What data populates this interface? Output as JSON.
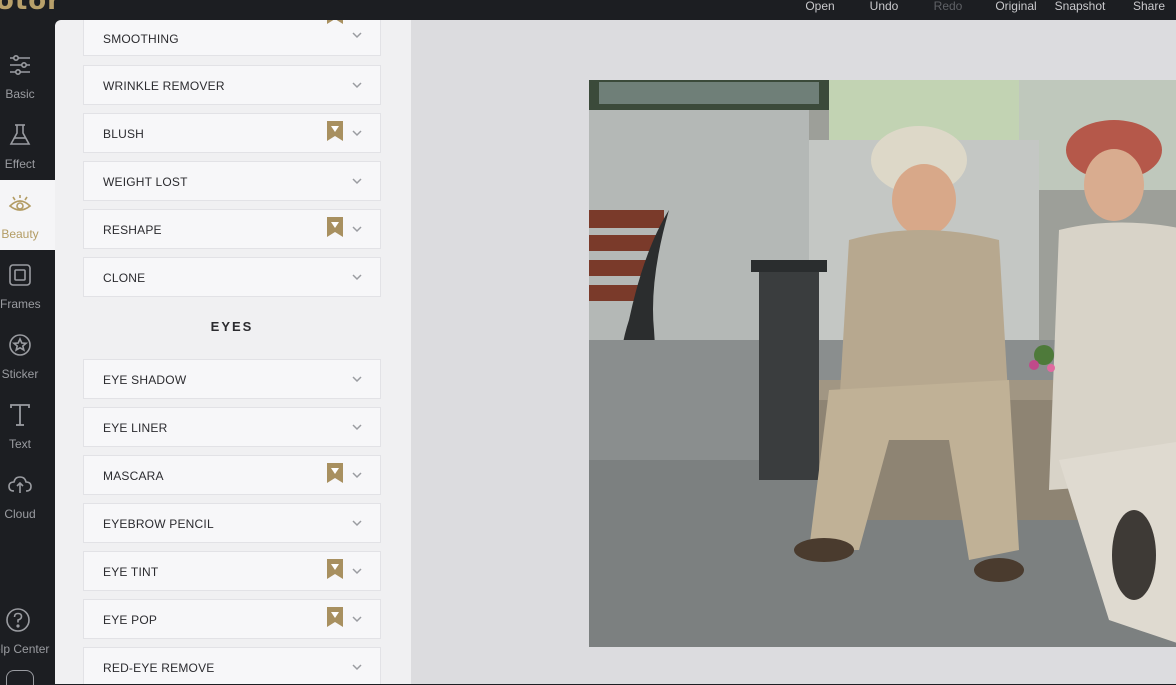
{
  "app": {
    "logo_text": "otor"
  },
  "topbar": {
    "menu": [
      {
        "label": "Open",
        "disabled": false
      },
      {
        "label": "Undo",
        "disabled": false
      },
      {
        "label": "Redo",
        "disabled": true
      },
      {
        "label": "Original",
        "disabled": false
      },
      {
        "label": "Snapshot",
        "disabled": false
      },
      {
        "label": "Share",
        "disabled": false
      }
    ]
  },
  "rail": {
    "items": [
      {
        "label": "Basic",
        "icon": "sliders-icon",
        "active": false
      },
      {
        "label": "Effect",
        "icon": "flask-icon",
        "active": false
      },
      {
        "label": "Beauty",
        "icon": "eye-icon",
        "active": true
      },
      {
        "label": "Frames",
        "icon": "frame-icon",
        "active": false
      },
      {
        "label": "Sticker",
        "icon": "star-circle-icon",
        "active": false
      },
      {
        "label": "Text",
        "icon": "text-icon",
        "active": false
      },
      {
        "label": "Cloud",
        "icon": "cloud-upload-icon",
        "active": false
      },
      {
        "label": "elp Center",
        "icon": "help-circle-icon",
        "active": false
      }
    ]
  },
  "panel": {
    "section_title": "EYES",
    "items": [
      {
        "label": "SMOOTHING",
        "premium": false
      },
      {
        "label": "WRINKLE REMOVER",
        "premium": false
      },
      {
        "label": "BLUSH",
        "premium": true
      },
      {
        "label": "WEIGHT LOST",
        "premium": false
      },
      {
        "label": "RESHAPE",
        "premium": true
      },
      {
        "label": "CLONE",
        "premium": false
      },
      {
        "label": "EYE SHADOW",
        "premium": false
      },
      {
        "label": "EYE LINER",
        "premium": false
      },
      {
        "label": "MASCARA",
        "premium": true
      },
      {
        "label": "EYEBROW PENCIL",
        "premium": false
      },
      {
        "label": "EYE TINT",
        "premium": true
      },
      {
        "label": "EYE POP",
        "premium": true
      },
      {
        "label": "RED-EYE REMOVE",
        "premium": false
      }
    ]
  },
  "colors": {
    "accent": "#b39c64",
    "dark": "#1c1e22",
    "panel": "#f0f0f2",
    "canvas": "#dcdcdf"
  }
}
